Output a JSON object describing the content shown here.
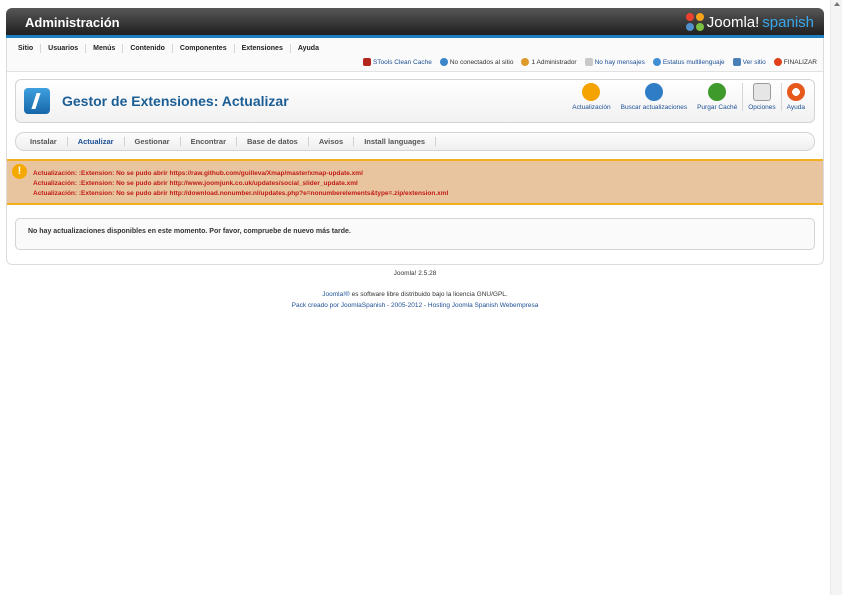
{
  "header": {
    "title": "Administración",
    "brand_name": "Joomla!",
    "brand_suffix": "spanish"
  },
  "menu": {
    "items": [
      "Sitio",
      "Usuarios",
      "Menús",
      "Contenido",
      "Componentes",
      "Extensiones",
      "Ayuda"
    ]
  },
  "status": {
    "cache": "STools Clean Cache",
    "visitors": "No conectados al sitio",
    "admins": "1 Administrador",
    "messages": "No hay mensajes",
    "multilang": "Estatus multilenguaje",
    "view_site": "Ver sitio",
    "logout": "FINALIZAR"
  },
  "toolbar": {
    "page_title": "Gestor de Extensiones: Actualizar",
    "update_label": "Actualización",
    "find_updates_label": "Buscar actualizaciones",
    "purge_cache_label": "Purgar Caché",
    "options_label": "Opciones",
    "help_label": "Ayuda"
  },
  "subnav": {
    "items": [
      "Instalar",
      "Actualizar",
      "Gestionar",
      "Encontrar",
      "Base de datos",
      "Avisos",
      "Install languages"
    ],
    "active_index": 1
  },
  "alerts": [
    "Actualización: :Extension: No se pudo abrir https://raw.github.com/guilleva/Xmap/master/xmap-update.xml",
    "Actualización: :Extension: No se pudo abrir http://www.joomjunk.co.uk/updates/social_slider_update.xml",
    "Actualización: :Extension: No se pudo abrir http://download.nonumber.nl/updates.php?e=nonumberelements&type=.zip/extension.xml"
  ],
  "main": {
    "message": "No hay actualizaciones disponibles en este momento. Por favor, compruebe de nuevo más tarde."
  },
  "footer": {
    "version": "Joomla! 2.5.28",
    "license_link": "Joomla!®",
    "license_text": " es software libre distribuido bajo la licencia GNU/GPL.",
    "credits": "Pack creado por JoomlaSpanish - 2005-2012 - Hosting Joomla Spanish Webempresa"
  },
  "colors": {
    "accent": "#1c7fc4",
    "alert_bg": "#e8c59e",
    "alert_text": "#c11b17",
    "link": "#1c4f94"
  }
}
